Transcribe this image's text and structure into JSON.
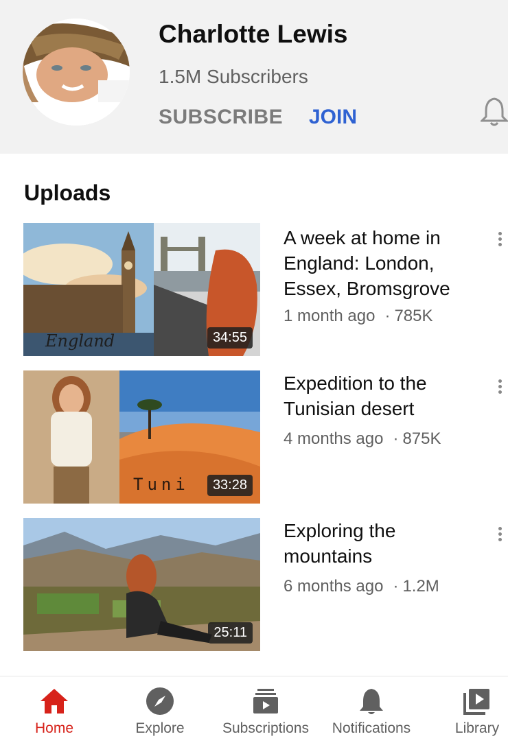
{
  "channel": {
    "name": "Charlotte Lewis",
    "subscribers": "1.5M Subscribers",
    "subscribe_label": "SUBSCRIBE",
    "join_label": "JOIN"
  },
  "uploads": {
    "title": "Uploads",
    "videos": [
      {
        "title": "A week at home in England: London, Essex, Bromsgrove",
        "age": "1 month ago",
        "views": "785K",
        "duration": "34:55",
        "thumb_caption": "England"
      },
      {
        "title": "Expedition to the Tunisian desert",
        "age": "4 months ago",
        "views": "875K",
        "duration": "33:28",
        "thumb_caption": "Tuni"
      },
      {
        "title": "Exploring the mountains",
        "age": "6 months ago",
        "views": "1.2M",
        "duration": "25:11"
      }
    ]
  },
  "nav": {
    "items": [
      {
        "label": "Home",
        "icon": "home-icon",
        "active": true
      },
      {
        "label": "Explore",
        "icon": "compass-icon"
      },
      {
        "label": "Subscriptions",
        "icon": "subscriptions-icon"
      },
      {
        "label": "Notifications",
        "icon": "bell-icon"
      },
      {
        "label": "Library",
        "icon": "library-icon"
      }
    ]
  },
  "colors": {
    "accent_red": "#d7221a",
    "join_blue": "#2f62d2",
    "header_bg": "#f2f2f2",
    "meta_grey": "#606060"
  },
  "separator": "·"
}
